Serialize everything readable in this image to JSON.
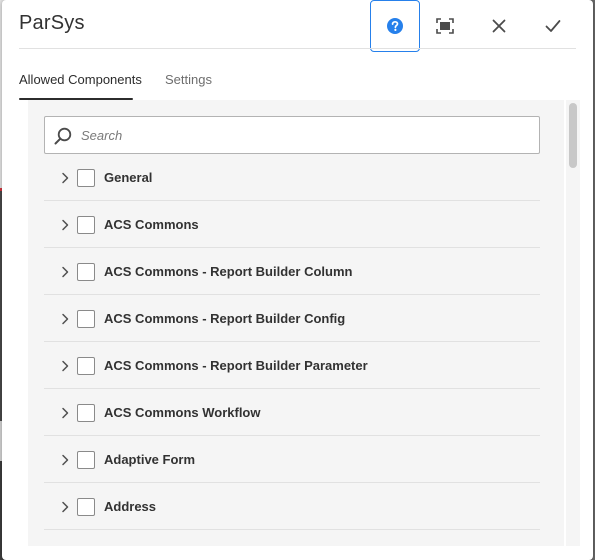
{
  "dialog": {
    "title": "ParSys",
    "header_icons": [
      "help-icon",
      "fullscreen-icon",
      "close-icon",
      "checkmark-icon"
    ],
    "accent_color": "#2680eb"
  },
  "tabs": [
    {
      "label": "Allowed Components",
      "selected": true
    },
    {
      "label": "Settings",
      "selected": false
    }
  ],
  "search": {
    "placeholder": "Search",
    "value": ""
  },
  "components": [
    {
      "label": "General",
      "checked": false,
      "expanded": false
    },
    {
      "label": "ACS Commons",
      "checked": false,
      "expanded": false
    },
    {
      "label": "ACS Commons - Report Builder Column",
      "checked": false,
      "expanded": false
    },
    {
      "label": "ACS Commons - Report Builder Config",
      "checked": false,
      "expanded": false
    },
    {
      "label": "ACS Commons - Report Builder Parameter",
      "checked": false,
      "expanded": false
    },
    {
      "label": "ACS Commons Workflow",
      "checked": false,
      "expanded": false
    },
    {
      "label": "Adaptive Form",
      "checked": false,
      "expanded": false
    },
    {
      "label": "Address",
      "checked": false,
      "expanded": false
    }
  ]
}
